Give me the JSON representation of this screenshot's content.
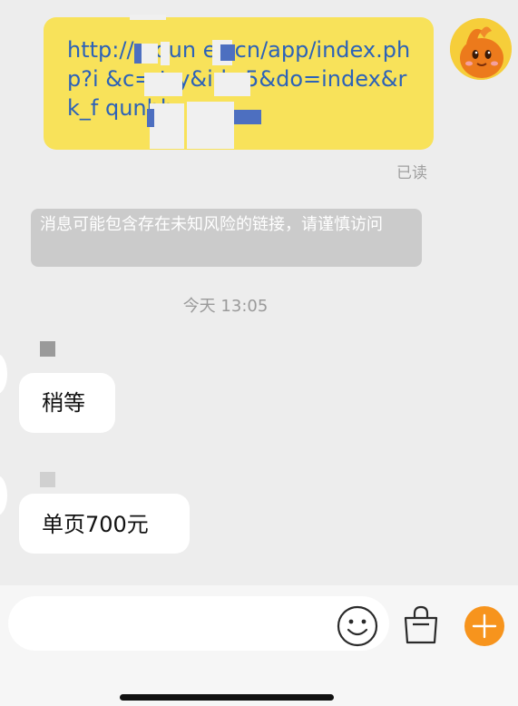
{
  "messages": {
    "outgoing_link": "http://p  qun  ez.cn/app/index.php?i  &c=  try&id=5&do=index&r  k_f  qunhb",
    "read_status": "已读",
    "risk_warning": "消息可能包含存在未知风险的链接，请谨慎访问",
    "timestamp": "今天 13:05",
    "incoming": [
      {
        "text": "稍等"
      },
      {
        "text": "单页700元"
      }
    ]
  },
  "input_bar": {
    "placeholder": "",
    "icons": [
      "emoji-icon",
      "shopping-bag-icon",
      "plus-icon"
    ]
  },
  "colors": {
    "background": "#ededed",
    "outgoing_bubble": "#f8e25a",
    "link_text": "#2c62b8",
    "incoming_bubble": "#ffffff",
    "warning_bubble": "#cbcbcb",
    "accent_plus": "#f7941d"
  }
}
